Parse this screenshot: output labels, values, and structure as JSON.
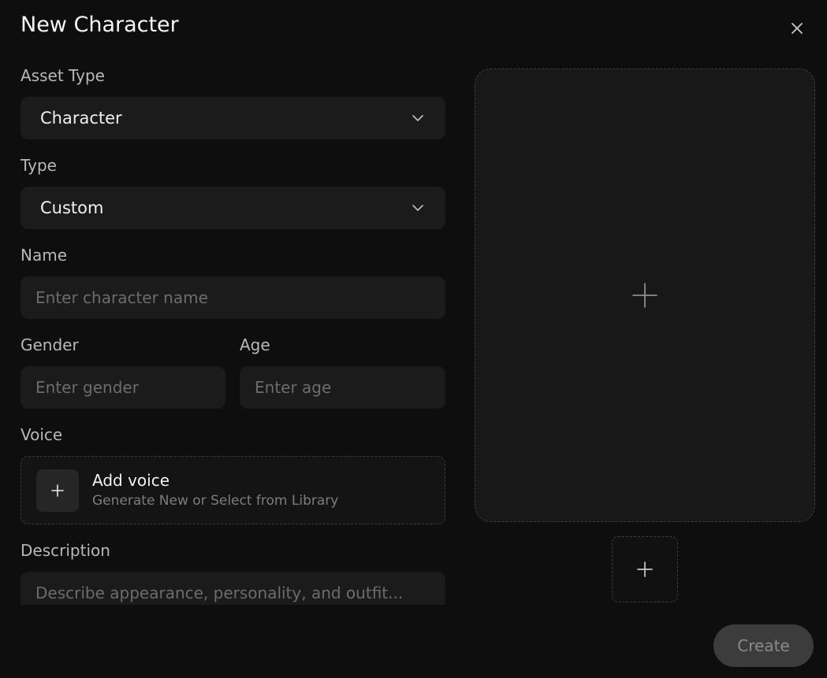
{
  "dialog": {
    "title": "New Character"
  },
  "form": {
    "asset_type": {
      "label": "Asset Type",
      "value": "Character"
    },
    "type": {
      "label": "Type",
      "value": "Custom"
    },
    "name": {
      "label": "Name",
      "placeholder": "Enter character name"
    },
    "gender": {
      "label": "Gender",
      "placeholder": "Enter gender"
    },
    "age": {
      "label": "Age",
      "placeholder": "Enter age"
    },
    "voice": {
      "label": "Voice",
      "title": "Add voice",
      "subtitle": "Generate New or Select from Library"
    },
    "description": {
      "label": "Description",
      "placeholder": "Describe appearance, personality, and outfit..."
    }
  },
  "actions": {
    "create_label": "Create"
  },
  "icons": {
    "close": "close-icon",
    "dropdown": "chevron-down-icon",
    "add": "plus-icon"
  }
}
